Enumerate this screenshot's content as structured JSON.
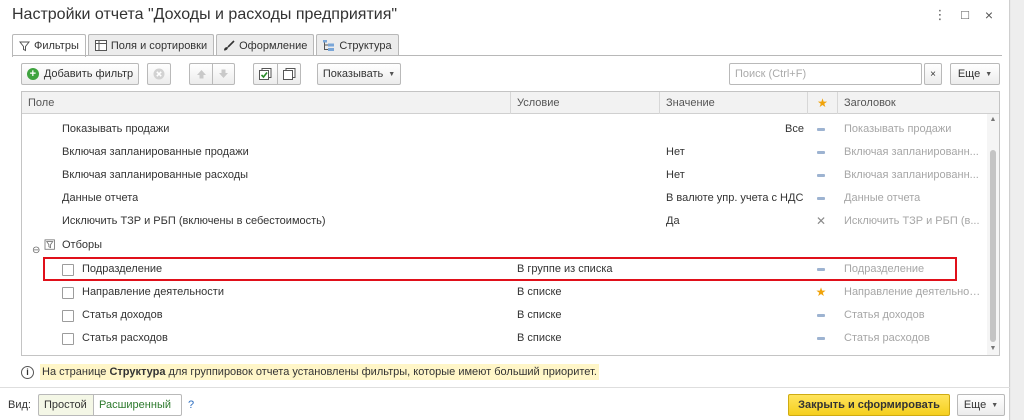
{
  "window": {
    "title": "Настройки отчета \"Доходы и расходы предприятия\"",
    "menu_glyph": "⋮",
    "max_glyph": "□",
    "close_glyph": "×"
  },
  "tabs": [
    {
      "label": "Фильтры",
      "icon": "filter-icon",
      "active": true
    },
    {
      "label": "Поля и сортировки",
      "icon": "table-icon",
      "active": false
    },
    {
      "label": "Оформление",
      "icon": "brush-icon",
      "active": false
    },
    {
      "label": "Структура",
      "icon": "tree-icon",
      "active": false
    }
  ],
  "toolbar": {
    "add_filter_label": "Добавить фильтр",
    "show_label": "Показывать",
    "search_placeholder": "Поиск (Ctrl+F)",
    "clear_label": "×",
    "more_label": "Еще"
  },
  "table": {
    "headers": {
      "field": "Поле",
      "condition": "Условие",
      "value": "Значение",
      "title": "Заголовок"
    },
    "settings_rows": [
      {
        "field": "Показывать продажи",
        "value": "Все",
        "flag": "dash",
        "title": "Показывать продажи"
      },
      {
        "field": "Включая запланированные продажи",
        "value": "Нет",
        "flag": "dash",
        "title": "Включая запланированн..."
      },
      {
        "field": "Включая запланированные расходы",
        "value": "Нет",
        "flag": "dash",
        "title": "Включая запланированн..."
      },
      {
        "field": "Данные отчета",
        "value": "В валюте упр. учета с НДС",
        "flag": "dash",
        "title": "Данные отчета"
      },
      {
        "field": "Исключить ТЗР и РБП (включены в себестоимость)",
        "value": "Да",
        "flag": "x",
        "title": "Исключить ТЗР и РБП (в..."
      }
    ],
    "group_label": "Отборы",
    "filter_rows": [
      {
        "field": "Подразделение",
        "condition": "В группе из списка",
        "flag": "dash",
        "title": "Подразделение"
      },
      {
        "field": "Направление деятельности",
        "condition": "В списке",
        "flag": "star",
        "title": "Направление деятельности"
      },
      {
        "field": "Статья доходов",
        "condition": "В списке",
        "flag": "dash",
        "title": "Статья доходов"
      },
      {
        "field": "Статья расходов",
        "condition": "В списке",
        "flag": "dash",
        "title": "Статья расходов"
      }
    ]
  },
  "info": {
    "text_before": "На странице ",
    "text_bold": "Структура",
    "text_after": " для группировок отчета установлены фильтры, которые имеют больший приоритет."
  },
  "footer": {
    "view_label": "Вид:",
    "simple_label": "Простой",
    "advanced_label": "Расширенный",
    "help_label": "?",
    "primary_label": "Закрыть и сформировать",
    "more_label": "Еще"
  },
  "colors": {
    "primary_button": "#f5cf1e",
    "highlight_border": "#e0101a",
    "star": "#f0a30a",
    "info_background": "#fff6c8"
  }
}
